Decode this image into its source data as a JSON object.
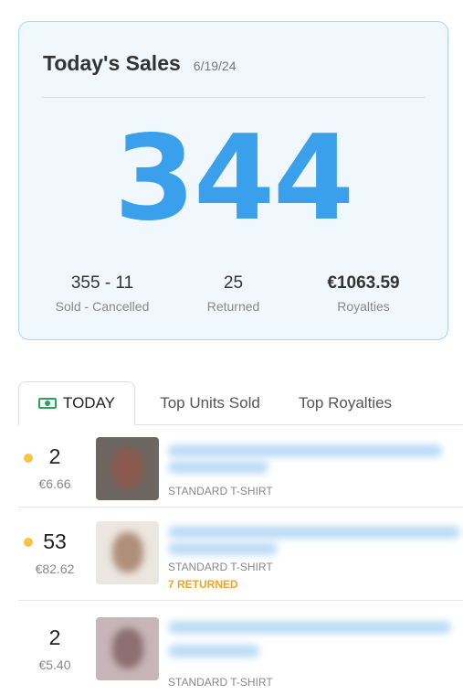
{
  "summary": {
    "title": "Today's Sales",
    "date": "6/19/24",
    "total": "344",
    "stats": [
      {
        "value": "355 - 11",
        "label": "Sold - Cancelled"
      },
      {
        "value": "25",
        "label": "Returned"
      },
      {
        "value": "€1063.59",
        "label": "Royalties"
      }
    ]
  },
  "tabs": [
    {
      "label": "TODAY",
      "icon": "money-icon",
      "active": true
    },
    {
      "label": "Top Units Sold",
      "active": false
    },
    {
      "label": "Top Royalties",
      "active": false
    }
  ],
  "sales": [
    {
      "quantity": "2",
      "price": "€6.66",
      "product_type": "STANDARD T-SHIRT",
      "returned": "",
      "dot": true
    },
    {
      "quantity": "53",
      "price": "€82.62",
      "product_type": "STANDARD T-SHIRT",
      "returned": "7 RETURNED",
      "dot": true
    },
    {
      "quantity": "2",
      "price": "€5.40",
      "product_type": "STANDARD T-SHIRT",
      "returned": "",
      "dot": false
    }
  ],
  "colors": {
    "accent": "#3aa0ec",
    "card_bg": "#f0f8fd",
    "dot": "#f7c245",
    "returned": "#efa427",
    "money_icon": "#29a55a"
  }
}
